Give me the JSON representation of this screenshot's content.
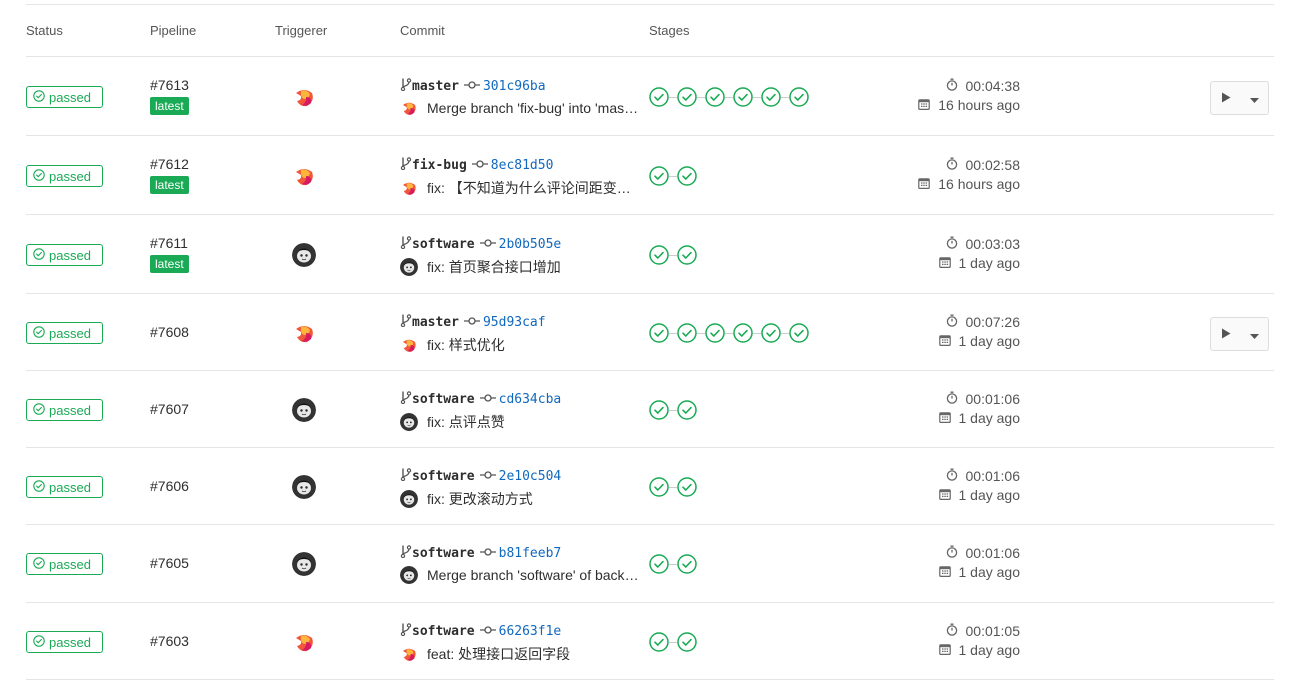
{
  "headers": {
    "status": "Status",
    "pipeline": "Pipeline",
    "triggerer": "Triggerer",
    "commit": "Commit",
    "stages": "Stages"
  },
  "colors": {
    "success": "#1aaa55",
    "sha": "#1068bf"
  },
  "rows": [
    {
      "status": "passed",
      "id": "#7613",
      "latest": "latest",
      "avatar": "gradient-avatar",
      "branch": "master",
      "sha": "301c96ba",
      "message": "Merge branch 'fix-bug' into 'master'",
      "stages": 6,
      "duration": "00:04:38",
      "finished": "16 hours ago",
      "has_action": true
    },
    {
      "status": "passed",
      "id": "#7612",
      "latest": "latest",
      "avatar": "gradient-avatar",
      "branch": "fix-bug",
      "sha": "8ec81d50",
      "message": "fix: 【不知道为什么评论间距变小了】",
      "stages": 2,
      "duration": "00:02:58",
      "finished": "16 hours ago",
      "has_action": false
    },
    {
      "status": "passed",
      "id": "#7611",
      "latest": "latest",
      "avatar": "dark-avatar",
      "branch": "software",
      "sha": "2b0b505e",
      "message": "fix: 首页聚合接口增加",
      "stages": 2,
      "duration": "00:03:03",
      "finished": "1 day ago",
      "has_action": false
    },
    {
      "status": "passed",
      "id": "#7608",
      "latest": "",
      "avatar": "gradient-avatar",
      "branch": "master",
      "sha": "95d93caf",
      "message": "fix: 样式优化",
      "stages": 6,
      "duration": "00:07:26",
      "finished": "1 day ago",
      "has_action": true
    },
    {
      "status": "passed",
      "id": "#7607",
      "latest": "",
      "avatar": "dark-avatar",
      "branch": "software",
      "sha": "cd634cba",
      "message": "fix: 点评点赞",
      "stages": 2,
      "duration": "00:01:06",
      "finished": "1 day ago",
      "has_action": false
    },
    {
      "status": "passed",
      "id": "#7606",
      "latest": "",
      "avatar": "dark-avatar",
      "branch": "software",
      "sha": "2e10c504",
      "message": "fix: 更改滚动方式",
      "stages": 2,
      "duration": "00:01:06",
      "finished": "1 day ago",
      "has_action": false
    },
    {
      "status": "passed",
      "id": "#7605",
      "latest": "",
      "avatar": "dark-avatar",
      "branch": "software",
      "sha": "b81feeb7",
      "message": "Merge branch 'software' of backend",
      "stages": 2,
      "duration": "00:01:06",
      "finished": "1 day ago",
      "has_action": false
    },
    {
      "status": "passed",
      "id": "#7603",
      "latest": "",
      "avatar": "gradient-avatar",
      "branch": "software",
      "sha": "66263f1e",
      "message": "feat: 处理接口返回字段",
      "stages": 2,
      "duration": "00:01:05",
      "finished": "1 day ago",
      "has_action": false
    }
  ]
}
